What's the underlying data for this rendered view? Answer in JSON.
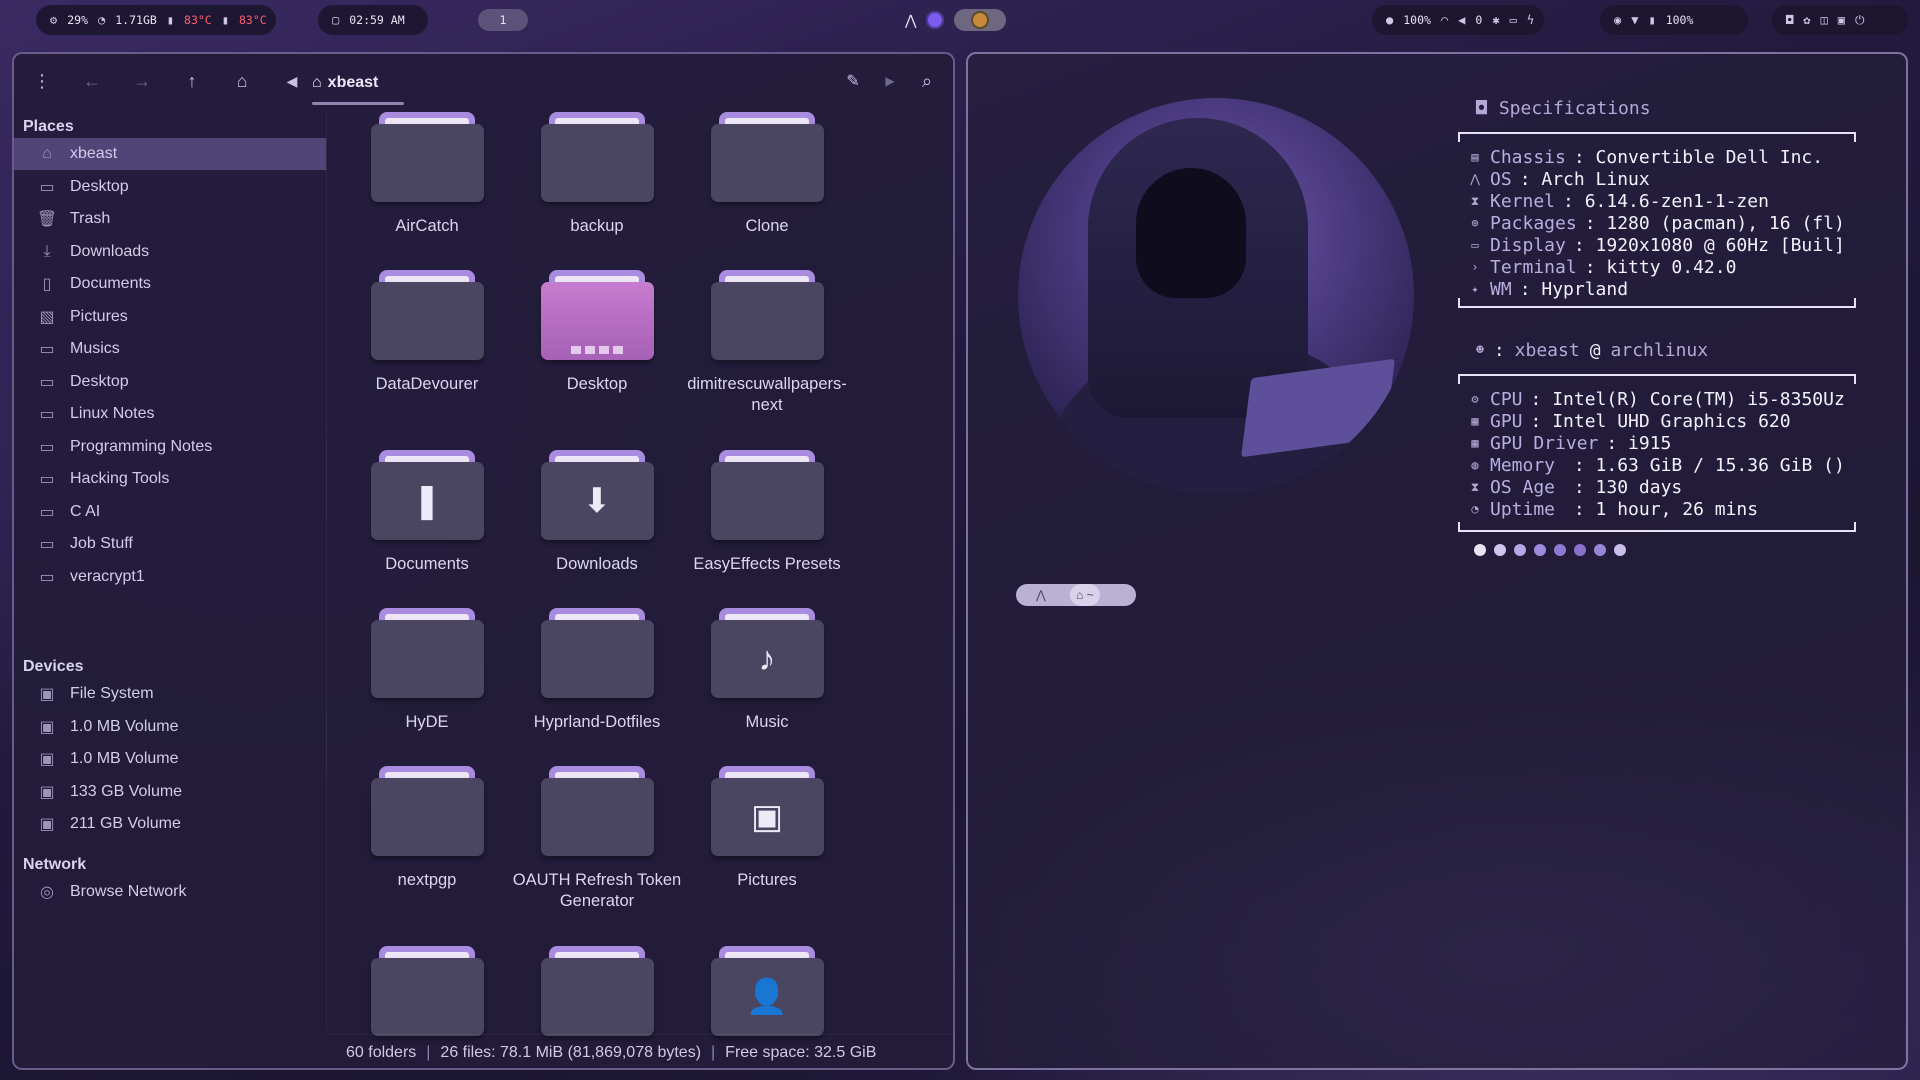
{
  "topbar": {
    "system": {
      "cpu": "29%",
      "mem": "1.71GB",
      "temp1": "83°C",
      "temp2": "83°C"
    },
    "clock": "02:59 AM",
    "workspace": "1",
    "right": {
      "brightness": "100%",
      "volume": "0",
      "battery": "100%"
    }
  },
  "filemanager": {
    "path": "xbeast",
    "places_header": "Places",
    "places": [
      {
        "label": "xbeast",
        "icon": "home-icon"
      },
      {
        "label": "Desktop",
        "icon": "desktop-icon"
      },
      {
        "label": "Trash",
        "icon": "trash-icon"
      },
      {
        "label": "Downloads",
        "icon": "download-icon"
      },
      {
        "label": "Documents",
        "icon": "document-icon"
      },
      {
        "label": "Pictures",
        "icon": "image-icon"
      },
      {
        "label": "Musics",
        "icon": "folder-icon"
      },
      {
        "label": "Desktop",
        "icon": "folder-icon"
      },
      {
        "label": "Linux Notes",
        "icon": "folder-icon"
      },
      {
        "label": "Programming Notes",
        "icon": "folder-icon"
      },
      {
        "label": "Hacking Tools",
        "icon": "folder-icon"
      },
      {
        "label": "C AI",
        "icon": "folder-icon"
      },
      {
        "label": "Job Stuff",
        "icon": "folder-icon"
      },
      {
        "label": "veracrypt1",
        "icon": "folder-icon"
      }
    ],
    "devices_header": "Devices",
    "devices": [
      {
        "label": "File System"
      },
      {
        "label": "1.0 MB Volume"
      },
      {
        "label": "1.0 MB Volume"
      },
      {
        "label": "133 GB Volume"
      },
      {
        "label": "211 GB Volume"
      }
    ],
    "network_header": "Network",
    "network": [
      {
        "label": "Browse Network"
      }
    ],
    "folders": [
      {
        "name": "AirCatch",
        "glyph": ""
      },
      {
        "name": "backup",
        "glyph": ""
      },
      {
        "name": "Clone",
        "glyph": ""
      },
      {
        "name": "DataDevourer",
        "glyph": ""
      },
      {
        "name": "Desktop",
        "glyph": "desktop"
      },
      {
        "name": "dimitrescuwallpapers-next",
        "glyph": ""
      },
      {
        "name": "Documents",
        "glyph": "❚"
      },
      {
        "name": "Downloads",
        "glyph": "⬇"
      },
      {
        "name": "EasyEffects Presets",
        "glyph": ""
      },
      {
        "name": "HyDE",
        "glyph": ""
      },
      {
        "name": "Hyprland-Dotfiles",
        "glyph": ""
      },
      {
        "name": "Music",
        "glyph": "♪"
      },
      {
        "name": "nextpgp",
        "glyph": ""
      },
      {
        "name": "OAUTH Refresh Token Generator",
        "glyph": ""
      },
      {
        "name": "Pictures",
        "glyph": "▣"
      },
      {
        "name": "",
        "glyph": ""
      },
      {
        "name": "",
        "glyph": ""
      },
      {
        "name": "",
        "glyph": "👤"
      }
    ],
    "status": {
      "folders": "60 folders",
      "files": "26 files: 78.1 MiB (81,869,078 bytes)",
      "free": "Free space: 32.5 GiB"
    }
  },
  "fastfetch": {
    "specs_title": "Specifications",
    "specs": [
      {
        "key": "Chassis",
        "value": ": Convertible Dell Inc."
      },
      {
        "key": "OS",
        "value": ": Arch Linux"
      },
      {
        "key": "Kernel",
        "value": ": 6.14.6-zen1-1-zen"
      },
      {
        "key": "Packages",
        "value": ": 1280 (pacman), 16 (fl)"
      },
      {
        "key": "Display",
        "value": ": 1920x1080 @ 60Hz [Buil]"
      },
      {
        "key": "Terminal",
        "value": ": kitty 0.42.0"
      },
      {
        "key": "WM",
        "value": ": Hyprland"
      }
    ],
    "user_sep": ":",
    "user": "xbeast",
    "at": "@",
    "host": "archlinux",
    "hw": [
      {
        "key": "CPU",
        "value": ": Intel(R) Core(TM) i5-8350Uz"
      },
      {
        "key": "GPU",
        "value": ": Intel UHD Graphics 620"
      },
      {
        "key": "GPU Driver",
        "value": ": i915"
      },
      {
        "key": "Memory",
        "value": " : 1.63 GiB / 15.36 GiB ()"
      },
      {
        "key": "OS Age",
        "value": " : 130 days"
      },
      {
        "key": "Uptime",
        "value": " : 1 hour, 26 mins"
      }
    ],
    "palette": [
      "#e8e4f4",
      "#cfc6ee",
      "#b6a6e6",
      "#9f89de",
      "#8f7ad2",
      "#8a72cc",
      "#9a86d6",
      "#c9bdeb"
    ]
  },
  "colors": {
    "accent": "#a98be0",
    "folder": "#4a4561",
    "status_red": "#ff5d73"
  }
}
